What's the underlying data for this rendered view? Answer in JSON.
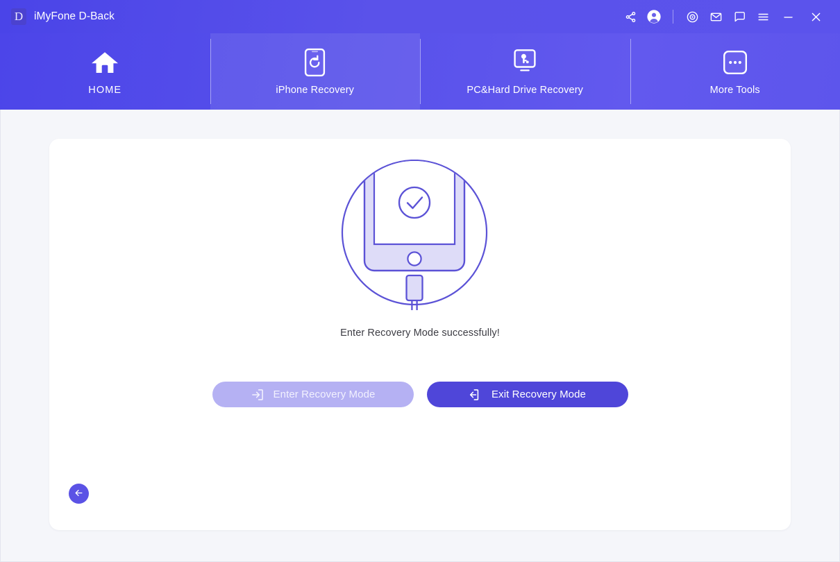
{
  "window": {
    "logo_letter": "D",
    "title": "iMyFone D-Back"
  },
  "title_bar": {
    "actions": [
      {
        "name": "share-icon",
        "label": "Share"
      },
      {
        "name": "account-icon",
        "label": "Account"
      },
      {
        "name": "support-icon",
        "label": "Support Center"
      },
      {
        "name": "mail-icon",
        "label": "Email Us"
      },
      {
        "name": "feedback-icon",
        "label": "Feedback"
      },
      {
        "name": "menu-icon",
        "label": "Menu"
      },
      {
        "name": "minimize-icon",
        "label": "Minimize"
      },
      {
        "name": "close-icon",
        "label": "Close"
      }
    ]
  },
  "nav": {
    "tabs": [
      {
        "label": "HOME",
        "icon": "home-icon",
        "active": false
      },
      {
        "label": "iPhone Recovery",
        "icon": "phone-refresh-icon",
        "active": true
      },
      {
        "label": "PC&Hard Drive Recovery",
        "icon": "monitor-key-icon",
        "active": false
      },
      {
        "label": "More Tools",
        "icon": "more-dots-icon",
        "active": false
      }
    ]
  },
  "main": {
    "illustration": "phone-check-connected-icon",
    "status_text": "Enter Recovery Mode successfully!",
    "buttons": {
      "enter": {
        "label": "Enter Recovery Mode",
        "icon": "enter-arrow-icon",
        "state": "disabled"
      },
      "exit": {
        "label": "Exit Recovery Mode",
        "icon": "exit-arrow-icon",
        "state": "enabled"
      }
    },
    "back_button": {
      "icon": "arrow-left-icon",
      "label": "Back"
    }
  },
  "colors": {
    "header_purple": "#5750ea",
    "accent_purple": "#4f46d9",
    "disabled_purple": "#b5b1f3",
    "illustration_stroke": "#5b52d6",
    "illustration_fill": "#dedcf8",
    "page_background": "#f5f6fa",
    "card_background": "#ffffff",
    "status_text": "#3d3d44"
  }
}
